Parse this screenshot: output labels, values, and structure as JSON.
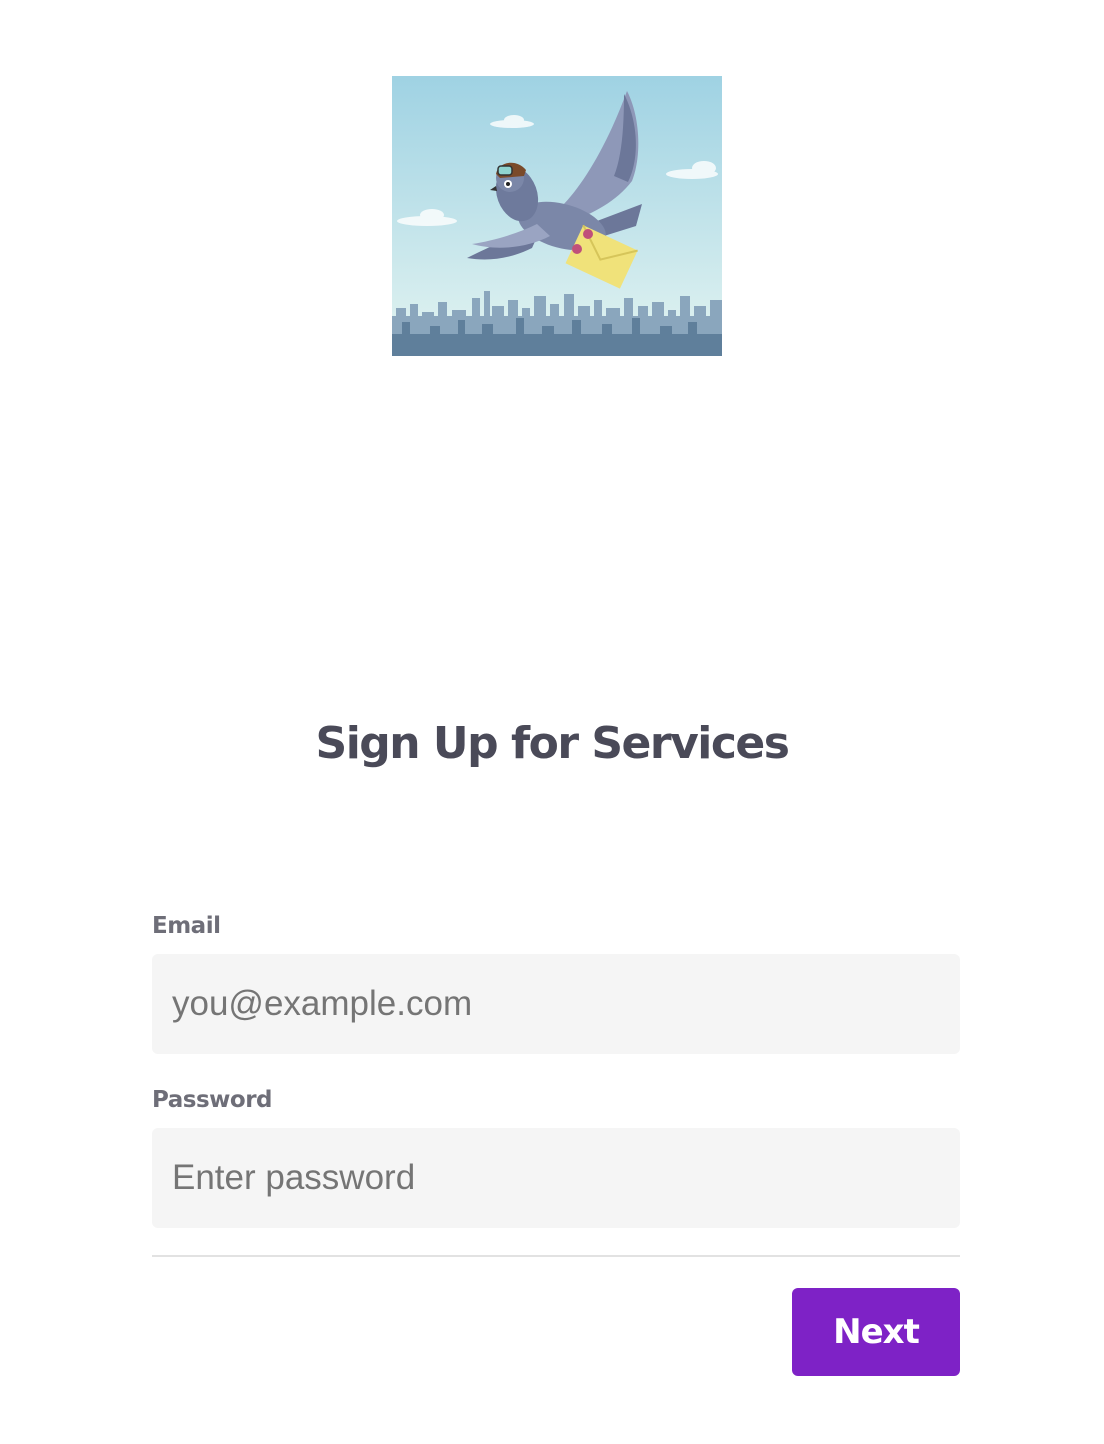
{
  "hero": {
    "image_name": "pigeon-mail-illustration",
    "sky_top_color": "#9fd2e3",
    "sky_bottom_color": "#e3f4f1",
    "city_color": "#6f8eaa",
    "bird_color": "#7b87a8",
    "envelope_color": "#f0e27a"
  },
  "page": {
    "title": "Sign Up for Services"
  },
  "form": {
    "email": {
      "label": "Email",
      "placeholder": "you@example.com",
      "value": ""
    },
    "password": {
      "label": "Password",
      "placeholder": "Enter password",
      "value": ""
    },
    "submit_label": "Next"
  },
  "colors": {
    "accent": "#7e22c6",
    "title_text": "#4a4a58",
    "label_text": "#6e6e78",
    "input_background": "#f5f5f5"
  }
}
